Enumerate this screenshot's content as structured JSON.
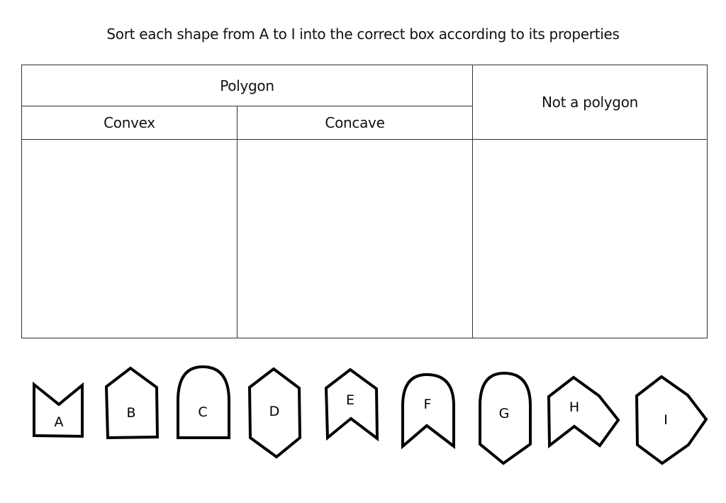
{
  "instruction": "Sort each shape from A to I into the correct box according to its properties",
  "table": {
    "polygon_header": "Polygon",
    "convex_header": "Convex",
    "concave_header": "Concave",
    "not_polygon_header": "Not a polygon"
  },
  "shapes": [
    {
      "label": "A",
      "kind": "notched-pentagon"
    },
    {
      "label": "B",
      "kind": "house-pentagon"
    },
    {
      "label": "C",
      "kind": "rounded-top-arch"
    },
    {
      "label": "D",
      "kind": "hexagon"
    },
    {
      "label": "E",
      "kind": "chevron-hexagon"
    },
    {
      "label": "F",
      "kind": "arch-with-notch"
    },
    {
      "label": "G",
      "kind": "arch-with-point"
    },
    {
      "label": "H",
      "kind": "irregular-concave-polygon"
    },
    {
      "label": "I",
      "kind": "irregular-convex-polygon"
    }
  ]
}
